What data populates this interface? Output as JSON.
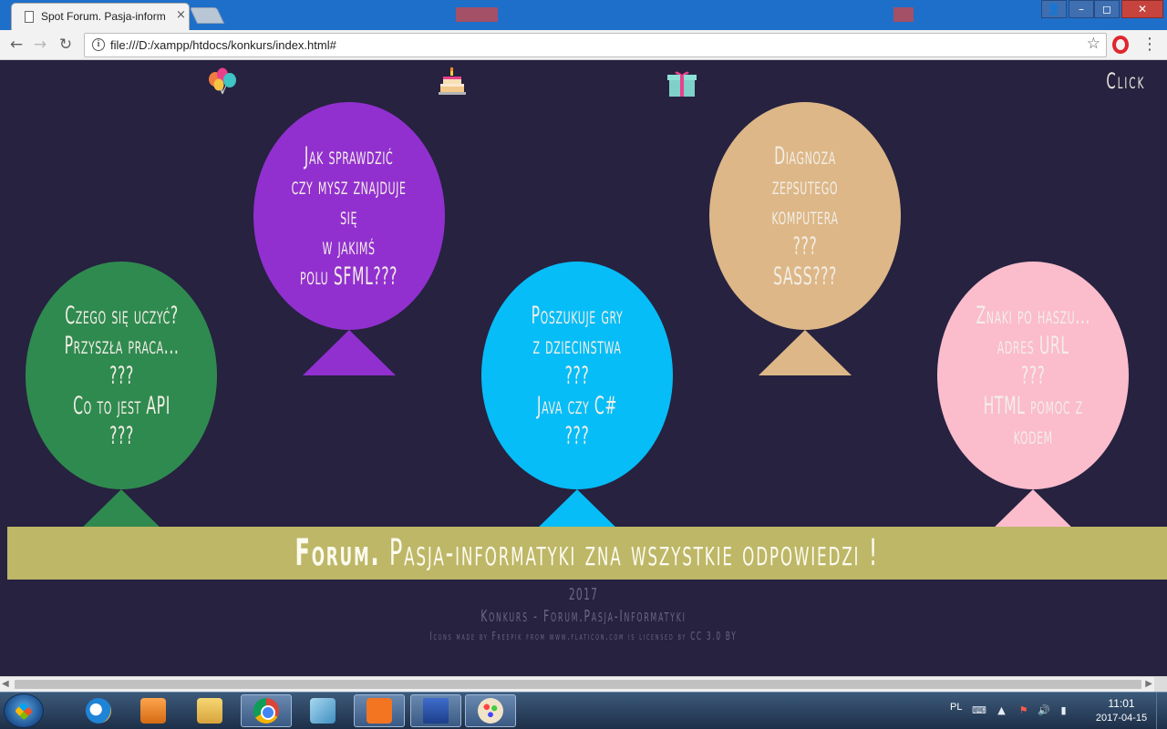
{
  "browser": {
    "tab_title": "Spot Forum. Pasja-inform",
    "tab_close": "×",
    "url": "file:///D:/xampp/htdocs/konkurs/index.html#",
    "nav": {
      "back": "←",
      "forward": "→",
      "reload": "↻"
    },
    "info_glyph": "i",
    "star_glyph": "☆",
    "menu_glyph": "⋮",
    "window": {
      "user": "👤",
      "minimize": "–",
      "maximize": "◻",
      "close": "✕"
    }
  },
  "page": {
    "click_link": "Click",
    "top_icons": [
      "balloons-icon",
      "cake-icon",
      "gift-icon"
    ],
    "balloons": [
      {
        "color": "#2f8a4f",
        "lines": [
          "Czego się uczyć?",
          "Przyszła praca...",
          "???",
          "Co to jest API",
          "???"
        ]
      },
      {
        "color": "#9130cf",
        "lines": [
          "Jak sprawdzić",
          "czy mysz znajduje",
          "się",
          "w jakimś",
          "polu SFML???"
        ]
      },
      {
        "color": "#06bdf7",
        "lines": [
          "Poszukuje gry",
          "z dziecinstwa",
          "???",
          "Java czy C#",
          "???"
        ]
      },
      {
        "color": "#ddb787",
        "lines": [
          "Diagnoza",
          "zepsutego",
          "komputera",
          "???",
          "SASS???"
        ]
      },
      {
        "color": "#fbbccc",
        "lines": [
          "Znaki po haszu...",
          "adres URL",
          "???",
          "HTML pomoc z",
          "kodem"
        ]
      }
    ],
    "banner": {
      "strong": "Forum.",
      "rest": " Pasja-informatyki zna wszystkie odpowiedzi !",
      "color": "#bdb767"
    },
    "footer": {
      "year": "2017",
      "title": "Konkurs - Forum.Pasja-Informatyki",
      "credits": "Icons made by Freepik from www.flaticon.com is licensed by CC 3.0 BY"
    },
    "background": "#262240"
  },
  "scrollbar": {
    "left_arrow": "◀",
    "right_arrow": "▶"
  },
  "taskbar": {
    "apps": [
      "internet-explorer-icon",
      "media-player-icon",
      "file-explorer-icon",
      "chrome-icon",
      "notepad-icon",
      "xampp-icon",
      "save-disk-icon",
      "paint-icon"
    ],
    "tray": {
      "language": "PL",
      "keyboard_glyph": "⌨",
      "arrow_glyph": "▲",
      "flag_glyph": "⚑",
      "sound_glyph": "🔊",
      "battery_glyph": "▮"
    },
    "clock": {
      "time": "11:01",
      "date": "2017-04-15"
    }
  }
}
